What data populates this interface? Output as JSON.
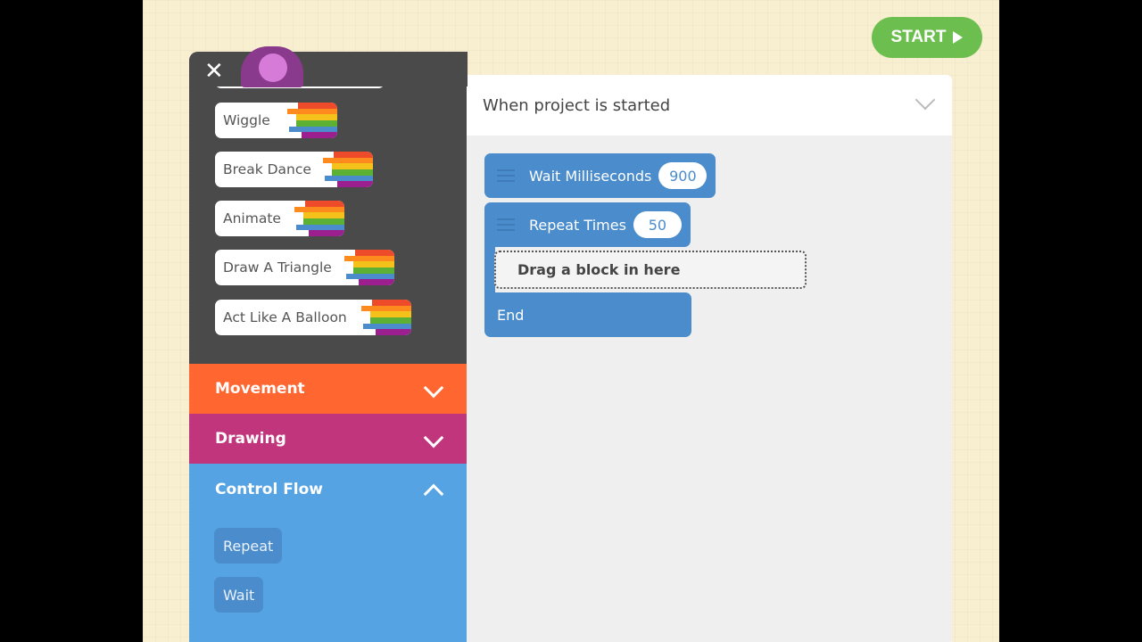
{
  "start_button": {
    "label": "START",
    "icon": "play-icon"
  },
  "palette": {
    "close_icon": "close-icon",
    "blocks": [
      {
        "label": "Wiggle"
      },
      {
        "label": "Break Dance"
      },
      {
        "label": "Animate"
      },
      {
        "label": "Draw A Triangle"
      },
      {
        "label": "Act Like A Balloon"
      }
    ],
    "categories": [
      {
        "label": "Movement",
        "color": "#ff6630",
        "state": "collapsed"
      },
      {
        "label": "Drawing",
        "color": "#c1357c",
        "state": "collapsed"
      },
      {
        "label": "Control Flow",
        "color": "#55a3e3",
        "state": "expanded"
      }
    ],
    "control_flow_blocks": [
      {
        "label": "Repeat"
      },
      {
        "label": "Wait"
      }
    ]
  },
  "editor": {
    "title": "When project is started",
    "wait": {
      "label": "Wait Milliseconds",
      "value": "900"
    },
    "repeat": {
      "label": "Repeat Times",
      "value": "50"
    },
    "drop_zone": "Drag a block in here",
    "end": "End"
  },
  "colors": {
    "block_blue": "#4a8ccc",
    "start_green": "#6cbf4f"
  }
}
